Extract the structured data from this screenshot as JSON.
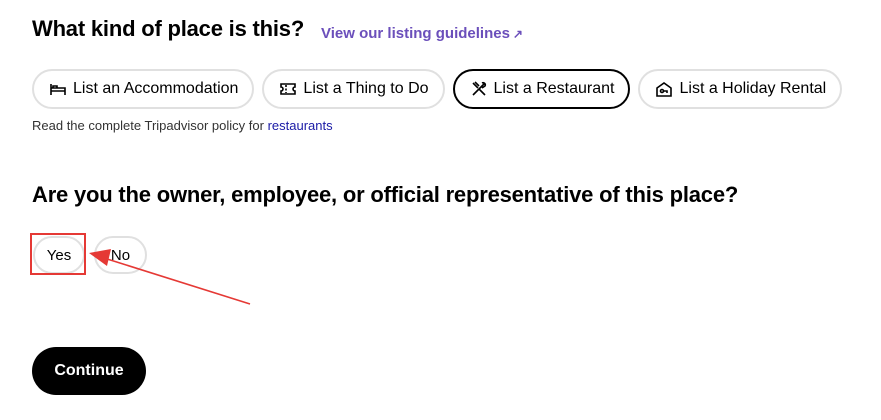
{
  "place_question": {
    "title": "What kind of place is this?",
    "guidelines_link": "View our listing guidelines",
    "guidelines_arrow": "↗"
  },
  "categories": [
    {
      "label": "List an Accommodation",
      "icon": "bed-icon",
      "selected": false
    },
    {
      "label": "List a Thing to Do",
      "icon": "ticket-icon",
      "selected": false
    },
    {
      "label": "List a Restaurant",
      "icon": "utensils-icon",
      "selected": true
    },
    {
      "label": "List a Holiday Rental",
      "icon": "house-icon",
      "selected": false
    }
  ],
  "policy": {
    "text": "Read the complete Tripadvisor policy for ",
    "link": "restaurants"
  },
  "owner_question": {
    "title": "Are you the owner, employee, or official representative of this place?",
    "yes_label": "Yes",
    "no_label": "No"
  },
  "continue_label": "Continue",
  "colors": {
    "link_purple": "#6b4fbb",
    "link_blue": "#1a1aa6",
    "annotation_red": "#e53935",
    "pill_border": "#e0e0e0"
  }
}
